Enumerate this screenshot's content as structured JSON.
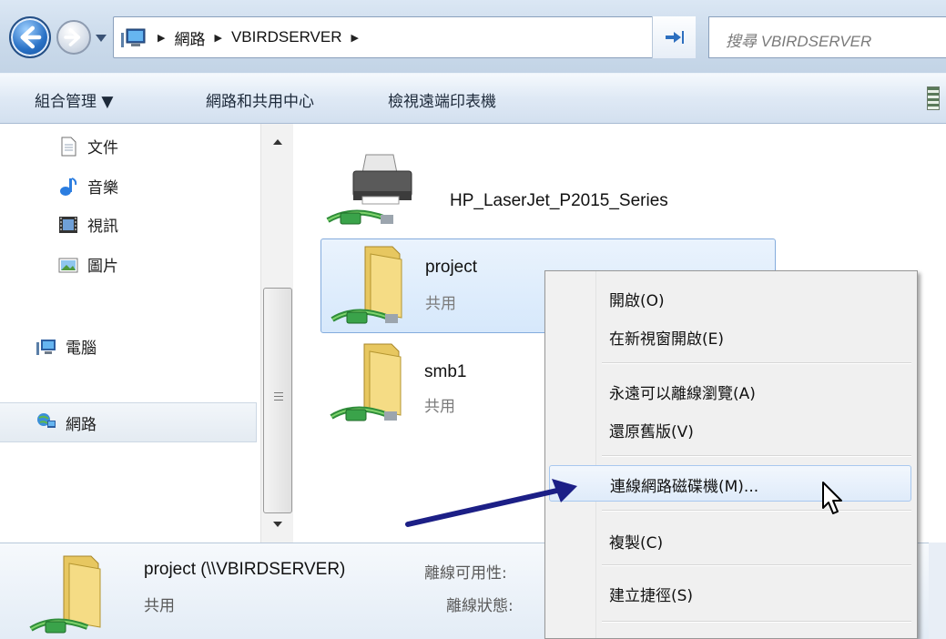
{
  "address_bar": {
    "computer_icon": "computer-icon",
    "breadcrumbs": [
      "網路",
      "VBIRDSERVER"
    ],
    "search_placeholder": "搜尋 VBIRDSERVER"
  },
  "command_bar": {
    "organize": "組合管理 ▼",
    "network_center": "網路和共用中心",
    "view_printers": "檢視遠端印表機"
  },
  "nav_pane": {
    "items": [
      {
        "label": "文件",
        "icon": "document-icon"
      },
      {
        "label": "音樂",
        "icon": "music-icon"
      },
      {
        "label": "視訊",
        "icon": "video-icon"
      },
      {
        "label": "圖片",
        "icon": "picture-icon"
      },
      {
        "label": "電腦",
        "icon": "computer-icon"
      },
      {
        "label": "網路",
        "icon": "network-icon"
      }
    ],
    "selected": "網路"
  },
  "content": {
    "items": [
      {
        "name": "HP_LaserJet_P2015_Series",
        "sub": "",
        "icon": "network-printer-icon"
      },
      {
        "name": "project",
        "sub": "共用",
        "icon": "shared-folder-icon"
      },
      {
        "name": "smb1",
        "sub": "共用",
        "icon": "shared-folder-icon"
      }
    ]
  },
  "context_menu": {
    "items": [
      "開啟(O)",
      "在新視窗開啟(E)",
      "永遠可以離線瀏覽(A)",
      "還原舊版(V)",
      "連線網路磁碟機(M)...",
      "複製(C)",
      "建立捷徑(S)"
    ],
    "highlighted": "連線網路磁碟機(M)..."
  },
  "details": {
    "name": "project (\\\\VBIRDSERVER)",
    "type": "共用",
    "offline_availability_label": "離線可用性:",
    "offline_status_label": "離線狀態:"
  },
  "colors": {
    "accent": "#2a72c6",
    "selection": "#d6e8fb",
    "annotation_arrow": "#1c1f86"
  }
}
